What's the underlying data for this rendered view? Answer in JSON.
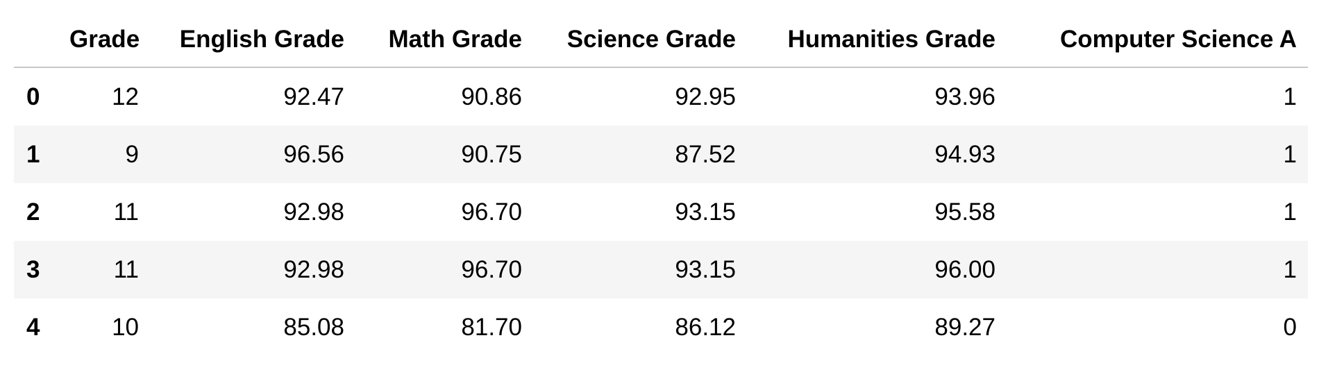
{
  "table": {
    "columns": [
      "",
      "Grade",
      "English Grade",
      "Math Grade",
      "Science Grade",
      "Humanities Grade",
      "Computer Science A"
    ],
    "rows": [
      {
        "index": "0",
        "cells": [
          "12",
          "92.47",
          "90.86",
          "92.95",
          "93.96",
          "1"
        ]
      },
      {
        "index": "1",
        "cells": [
          "9",
          "96.56",
          "90.75",
          "87.52",
          "94.93",
          "1"
        ]
      },
      {
        "index": "2",
        "cells": [
          "11",
          "92.98",
          "96.70",
          "93.15",
          "95.58",
          "1"
        ]
      },
      {
        "index": "3",
        "cells": [
          "11",
          "92.98",
          "96.70",
          "93.15",
          "96.00",
          "1"
        ]
      },
      {
        "index": "4",
        "cells": [
          "10",
          "85.08",
          "81.70",
          "86.12",
          "89.27",
          "0"
        ]
      }
    ]
  }
}
